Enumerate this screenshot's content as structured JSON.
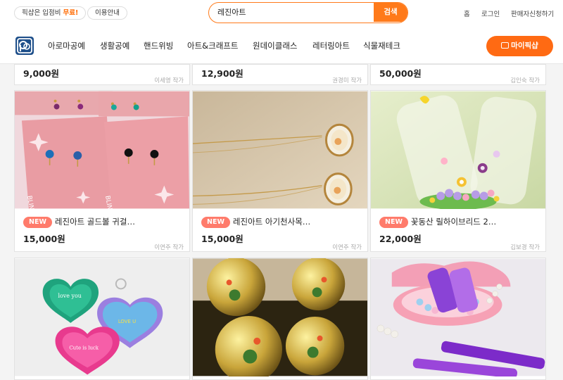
{
  "topbar": {
    "promo_text": "픽샵은 입점비 ",
    "promo_accent": "무료!",
    "guide": "이용안내",
    "search_value": "레진아트",
    "search_button": "검색",
    "links": [
      "홈",
      "로그인",
      "판매자신청하기"
    ]
  },
  "nav": {
    "items": [
      "아로마공예",
      "생활공예",
      "핸드위빙",
      "아트&크래프트",
      "원데이클래스",
      "레터링아트",
      "식물재테크"
    ],
    "my_button": "마이픽샵"
  },
  "products_top": [
    {
      "price": "9,000원",
      "artist": "이세영 작가"
    },
    {
      "price": "12,900원",
      "artist": "권경미 작가"
    },
    {
      "price": "50,000원",
      "artist": "김인숙 작가"
    }
  ],
  "products_mid": [
    {
      "badge": "NEW",
      "title": "레진아트 골드볼 귀걸…",
      "price": "15,000원",
      "artist": "이연주 작가",
      "image": "earrings"
    },
    {
      "badge": "NEW",
      "title": "레진아트 아기천사목…",
      "price": "15,000원",
      "artist": "이연주 작가",
      "image": "necklace"
    },
    {
      "badge": "NEW",
      "title": "꽃동산 릴하이브리드 2…",
      "price": "22,000원",
      "artist": "김보경 작가",
      "image": "resin-flowers"
    }
  ],
  "products_bottom": [
    {
      "image": "heart-keychains",
      "image_text": [
        "love you",
        "LOVE U",
        "Cute is luck"
      ]
    },
    {
      "image": "resin-spheres"
    },
    {
      "image": "resin-hairpins"
    }
  ]
}
